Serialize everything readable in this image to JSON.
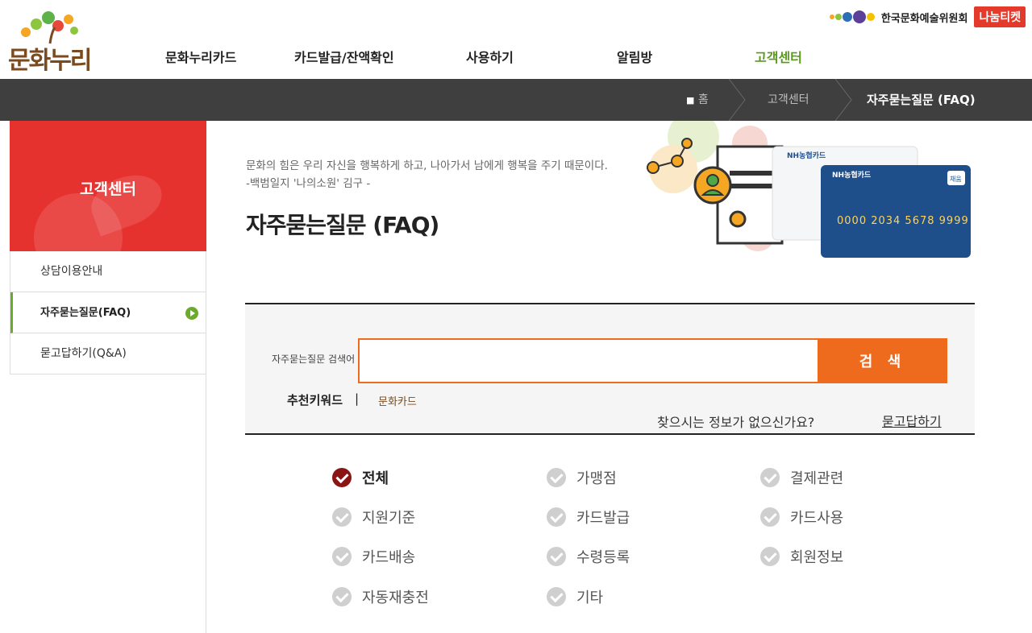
{
  "brand": {
    "logo_text": "문화누리",
    "arko_name": "한국문화예술위원회",
    "nanum_ticket": "나눔티켓"
  },
  "gnb": [
    {
      "label": "문화누리카드",
      "active": false
    },
    {
      "label": "카드발급/잔액확인",
      "active": false
    },
    {
      "label": "사용하기",
      "active": false
    },
    {
      "label": "알림방",
      "active": false
    },
    {
      "label": "고객센터",
      "active": true
    }
  ],
  "breadcrumb": {
    "home": "홈",
    "section": "고객센터",
    "current": "자주묻는질문 (FAQ)"
  },
  "sidebar": {
    "title": "고객센터",
    "items": [
      {
        "label": "상담이용안내",
        "active": false
      },
      {
        "label": "자주묻는질문(FAQ)",
        "active": true
      },
      {
        "label": "묻고답하기(Q&A)",
        "active": false
      }
    ]
  },
  "content": {
    "quote_line1": "문화의 힘은 우리 자신을 행복하게 하고, 나아가서 남에게 행복을 주기 때문이다.",
    "quote_line2": "-백범일지 '나의소원' 김구 -",
    "title": "자주묻는질문 (FAQ)"
  },
  "visual": {
    "card_brand": "NH농협카드",
    "card_number": "0000 2034 5678 9999",
    "card_badge": "채움"
  },
  "search": {
    "label": "자주묻는질문 검색어",
    "value": "",
    "placeholder": "",
    "button_label": "검 색",
    "keyword_label": "추천키워드",
    "keyword_separator": "|",
    "keywords": [
      "문화카드"
    ],
    "not_found_text": "찾으시는 정보가 없으신가요?",
    "qna_link": "묻고답하기"
  },
  "categories": [
    {
      "label": "전체",
      "selected": true
    },
    {
      "label": "가맹점",
      "selected": false
    },
    {
      "label": "결제관련",
      "selected": false
    },
    {
      "label": "지원기준",
      "selected": false
    },
    {
      "label": "카드발급",
      "selected": false
    },
    {
      "label": "카드사용",
      "selected": false
    },
    {
      "label": "카드배송",
      "selected": false
    },
    {
      "label": "수령등록",
      "selected": false
    },
    {
      "label": "회원정보",
      "selected": false
    },
    {
      "label": "자동재충전",
      "selected": false
    },
    {
      "label": "기타",
      "selected": false
    }
  ],
  "colors": {
    "accent_orange": "#ee6b1d",
    "active_green": "#5a9a1a",
    "sidebar_red": "#e6322f",
    "breadcrumb_bg": "#3f3f3f",
    "selected_check": "#8b1414"
  }
}
